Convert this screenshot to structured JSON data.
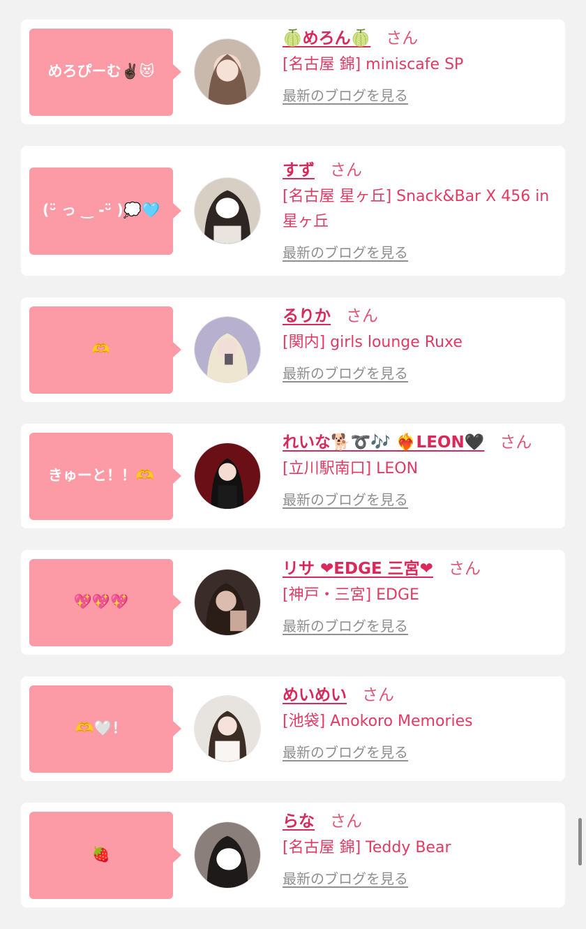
{
  "san_label": "さん",
  "blog_label": "最新のブログを見る",
  "colors": {
    "background": "#f2f2f2",
    "card": "#ffffff",
    "bubble": "#fc9aa6",
    "name": "#d9285a",
    "shop": "#e23a63",
    "link_gray": "#8f8f8f"
  },
  "entries": [
    {
      "comment": "めろぴーむ✌🏿😻",
      "name": "🍈めろん🍈",
      "shop": "[名古屋 錦] miniscafe SP"
    },
    {
      "comment": "(ᵕ̈ っ ‿ -ᵕ̈ )💭🩵",
      "name": "すず",
      "shop": "[名古屋 星ヶ丘] Snack&Bar X 456 in 星ヶ丘"
    },
    {
      "comment": "🫶",
      "name": "るりか",
      "shop": "[関内] girls lounge Ruxe"
    },
    {
      "comment": "きゅーと！！🫶",
      "name": "れいな🐕➰🎶 ❤️‍🔥LEON🖤",
      "shop": "[立川駅南口] LEON"
    },
    {
      "comment": "💖💖💖",
      "name": "リサ ❤EDGE 三宮❤",
      "shop": "[神戸・三宮] EDGE"
    },
    {
      "comment": "🫶🤍！",
      "name": "めいめい",
      "shop": "[池袋] Anokoro Memories"
    },
    {
      "comment": "🍓",
      "name": "らな",
      "shop": "[名古屋 錦] Teddy Bear"
    }
  ]
}
